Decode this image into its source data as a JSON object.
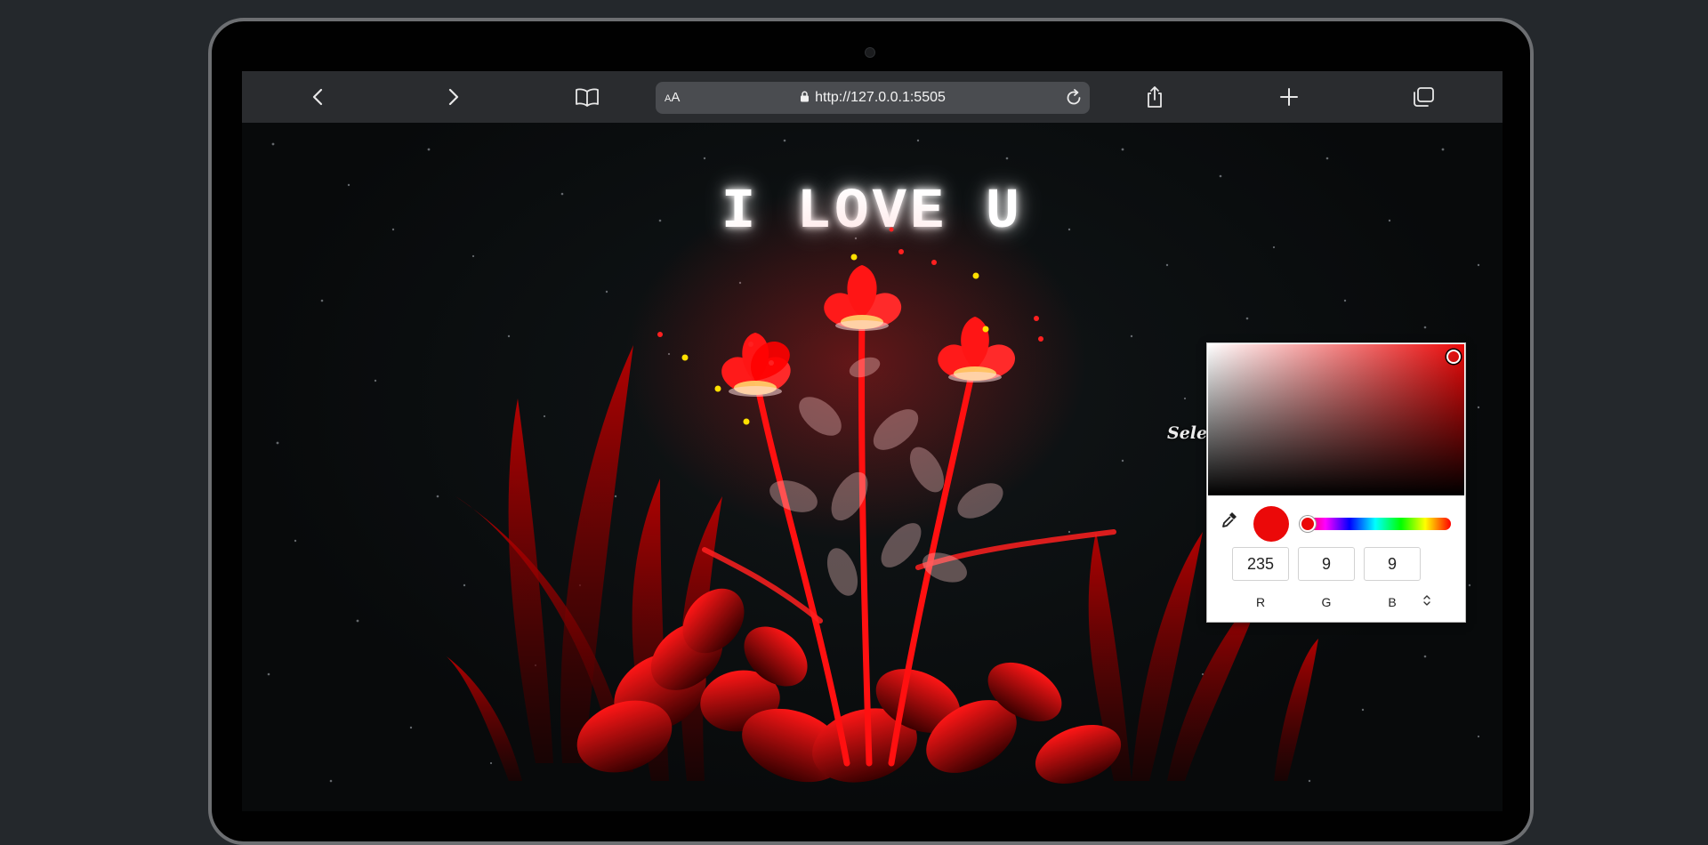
{
  "browser": {
    "url": "http://127.0.0.1:5505",
    "text_size_label_small": "A",
    "text_size_label_large": "A"
  },
  "page": {
    "headline": "I LOVE U",
    "select_label": "Select",
    "accent_color": "#eb0909"
  },
  "color_picker": {
    "current_color": "#eb0909",
    "r": "235",
    "g": "9",
    "b": "9",
    "r_label": "R",
    "g_label": "G",
    "b_label": "B"
  },
  "icons": [
    "back-icon",
    "forward-icon",
    "book-icon",
    "lock-icon",
    "reload-icon",
    "share-icon",
    "plus-icon",
    "tabs-icon",
    "eyedropper-icon",
    "mode-toggle-icon"
  ]
}
